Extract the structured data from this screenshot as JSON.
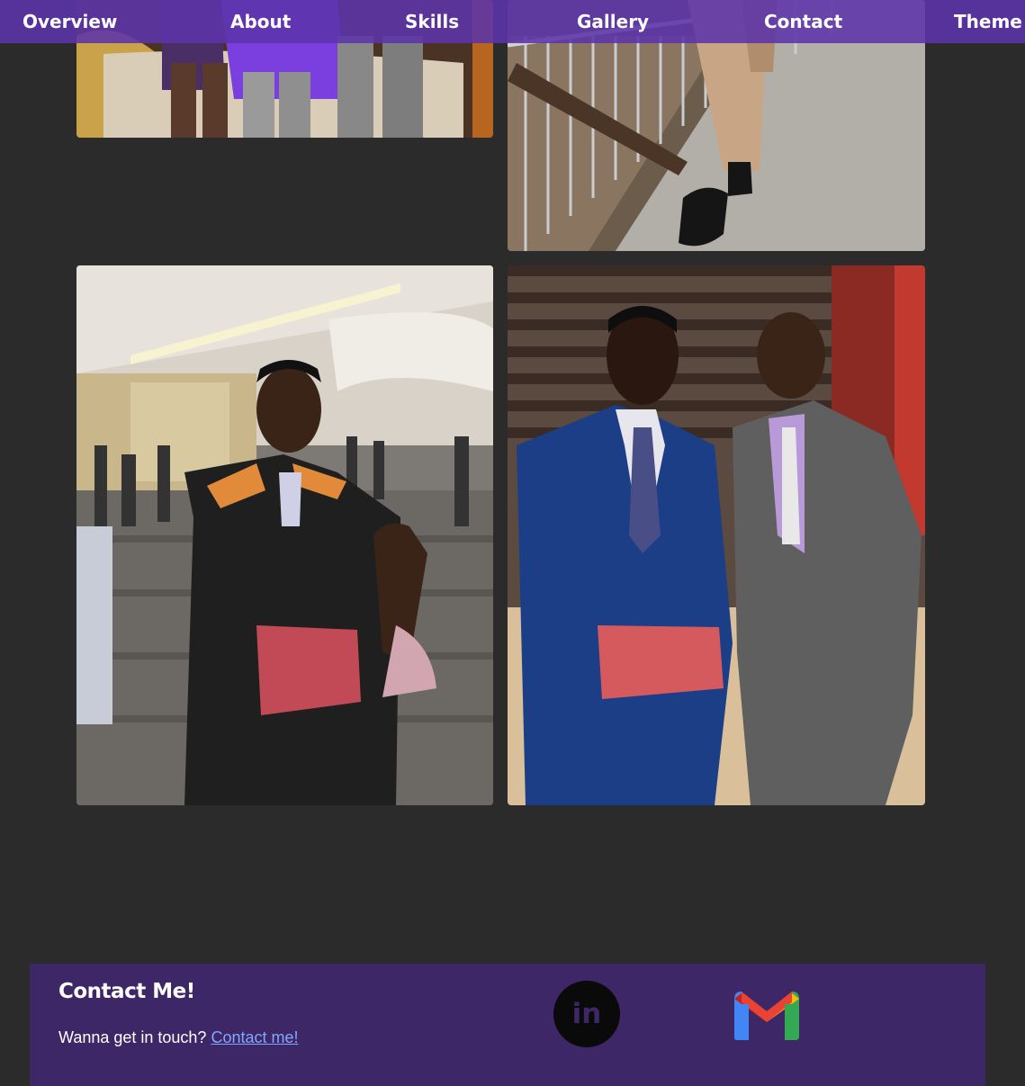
{
  "nav": {
    "items": [
      {
        "label": "Overview"
      },
      {
        "label": "About"
      },
      {
        "label": "Skills"
      },
      {
        "label": "Gallery"
      },
      {
        "label": "Contact"
      },
      {
        "label": "Theme"
      }
    ]
  },
  "gallery": {
    "photos": [
      {
        "name": "top-left-photo",
        "icon": "photo-people-sitting"
      },
      {
        "name": "top-right-photo",
        "icon": "photo-person-on-bridge"
      },
      {
        "name": "graduation-gown-photo",
        "icon": "photo-graduate-in-gown"
      },
      {
        "name": "graduation-suit-photo",
        "icon": "photo-graduate-with-father"
      }
    ]
  },
  "footer": {
    "title": "Contact Me!",
    "text": "Wanna get in touch?",
    "link": "Contact me!",
    "linkedin": {
      "icon": "linkedin-icon",
      "label": "in"
    },
    "gmail": {
      "icon": "gmail-icon"
    }
  },
  "colors": {
    "background": "#2b2b2b",
    "nav": "#5c34aa",
    "footer": "#3e2766",
    "link": "#7fa8ff"
  }
}
